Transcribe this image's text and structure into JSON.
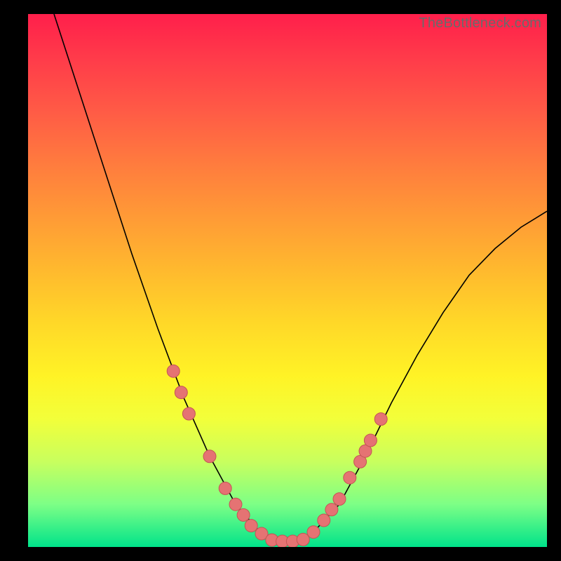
{
  "watermark": "TheBottleneck.com",
  "colors": {
    "gradient_top": "#ff1f4b",
    "gradient_bottom": "#00e38a",
    "curve": "#000000",
    "marker_fill": "#e57373",
    "marker_stroke": "#c35555",
    "frame": "#000000"
  },
  "chart_data": {
    "type": "line",
    "title": "",
    "xlabel": "",
    "ylabel": "",
    "xlim": [
      0,
      100
    ],
    "ylim": [
      0,
      100
    ],
    "legend": false,
    "grid": false,
    "curve_points": [
      {
        "x": 5,
        "y": 100
      },
      {
        "x": 10,
        "y": 85
      },
      {
        "x": 15,
        "y": 70
      },
      {
        "x": 20,
        "y": 55
      },
      {
        "x": 25,
        "y": 41
      },
      {
        "x": 30,
        "y": 28
      },
      {
        "x": 35,
        "y": 17
      },
      {
        "x": 40,
        "y": 8
      },
      {
        "x": 45,
        "y": 2.5
      },
      {
        "x": 48,
        "y": 1.2
      },
      {
        "x": 50,
        "y": 1
      },
      {
        "x": 52,
        "y": 1.2
      },
      {
        "x": 55,
        "y": 2.8
      },
      {
        "x": 60,
        "y": 8
      },
      {
        "x": 65,
        "y": 17
      },
      {
        "x": 70,
        "y": 27
      },
      {
        "x": 75,
        "y": 36
      },
      {
        "x": 80,
        "y": 44
      },
      {
        "x": 85,
        "y": 51
      },
      {
        "x": 90,
        "y": 56
      },
      {
        "x": 95,
        "y": 60
      },
      {
        "x": 100,
        "y": 63
      }
    ],
    "markers_left": [
      {
        "x": 28,
        "y": 33
      },
      {
        "x": 29.5,
        "y": 29
      },
      {
        "x": 31,
        "y": 25
      },
      {
        "x": 35,
        "y": 17
      },
      {
        "x": 38,
        "y": 11
      },
      {
        "x": 40,
        "y": 8
      },
      {
        "x": 41.5,
        "y": 6
      },
      {
        "x": 43,
        "y": 4
      },
      {
        "x": 45,
        "y": 2.5
      }
    ],
    "markers_bottom": [
      {
        "x": 47,
        "y": 1.3
      },
      {
        "x": 49,
        "y": 1.05
      },
      {
        "x": 51,
        "y": 1.05
      },
      {
        "x": 53,
        "y": 1.4
      },
      {
        "x": 55,
        "y": 2.8
      }
    ],
    "markers_right": [
      {
        "x": 57,
        "y": 5
      },
      {
        "x": 58.5,
        "y": 7
      },
      {
        "x": 60,
        "y": 9
      },
      {
        "x": 62,
        "y": 13
      },
      {
        "x": 64,
        "y": 16
      },
      {
        "x": 65,
        "y": 18
      },
      {
        "x": 66,
        "y": 20
      },
      {
        "x": 68,
        "y": 24
      }
    ]
  }
}
